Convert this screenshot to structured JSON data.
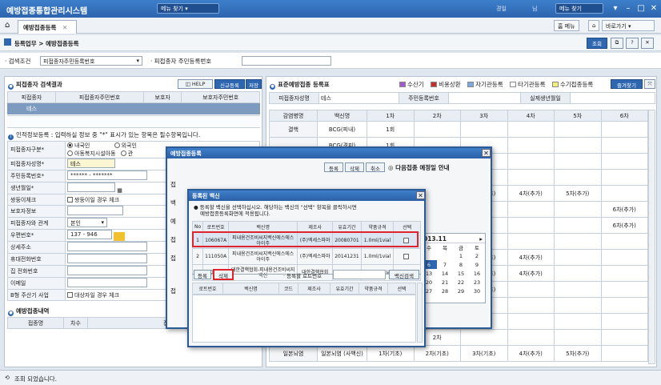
{
  "app": {
    "title": "예방접종통합관리시스템",
    "menu_pill": "메뉴 찾기",
    "menu_pill2": "메뉴 찾기",
    "top_user_a": "경일",
    "top_user_b": "님"
  },
  "tabs": [
    {
      "label": "예방접종등록"
    }
  ],
  "top_right": {
    "home": "홈 메뉴",
    "home_icon_label": "⌂",
    "logout": "바로가기 ▾"
  },
  "breadcrumb": {
    "root": "등록업무",
    "sep": ">",
    "page": "예방접종등록"
  },
  "crumb_buttons": {
    "search": "조회"
  },
  "search": {
    "cond_label": "· 검색조건",
    "cond_value": "피접종자주민등록번호",
    "rrn_label": "· 피접종자 주민등록번호"
  },
  "left": {
    "list_title": "피접종자 검색결과",
    "help": "HELP",
    "new": "신규등록",
    "save": "저장",
    "list_headers": [
      "피접종자",
      "피접종자주민번호",
      "보호자",
      "보호자주민번호"
    ],
    "list_rows": [
      [
        "테스",
        "",
        "",
        ""
      ]
    ],
    "notice": "인적정보등록 : 입력하실 정보 중 \"*\" 표시가 있는 항목은 필수항목입니다.",
    "form": [
      {
        "label": "피접종자구분*",
        "value": "내국인 / 외국인 / 아동복지시설아동 / 관"
      },
      {
        "label": "피접종자성명*",
        "value": "테스"
      },
      {
        "label": "주민등록번호*",
        "value": "****** - *******"
      },
      {
        "label": "생년월일*",
        "value": ""
      },
      {
        "label": "쌍둥이체크",
        "value": "쌍둥이일 경우 체크"
      },
      {
        "label": "보호자정보",
        "value": ""
      },
      {
        "label": "피접종자와 관계",
        "value": "본인"
      },
      {
        "label": "우편번호*",
        "value": "137 - 946"
      },
      {
        "label": "상세주소",
        "value": ""
      },
      {
        "label": "휴대전화번호",
        "value": ""
      },
      {
        "label": "집 전화번호",
        "value": ""
      },
      {
        "label": "이메일",
        "value": ""
      },
      {
        "label": "B형 주산기 사업",
        "value": "대상자일 경우 체크"
      }
    ],
    "radio": {
      "domestic": "내국인",
      "foreign": "외국인",
      "child": "아동복지시설아동",
      "etc": "관"
    },
    "hist_title": "예방접종내역",
    "hist_headers": [
      "접종명",
      "차수",
      "접종기관"
    ]
  },
  "right": {
    "title": "표준예방접종 등록표",
    "legend": [
      {
        "label": "수산기",
        "color": "#a25bc8"
      },
      {
        "label": "비용상환",
        "color": "#c6302a"
      },
      {
        "label": "자기관등록",
        "color": "#7da9e0"
      },
      {
        "label": "타기관등록",
        "color": "#ffffff"
      },
      {
        "label": "수기접종등록",
        "color": "#f2ee7a"
      }
    ],
    "fav_btn": "즐겨찾기",
    "info_labels": [
      "피접종자성명",
      "주민등록번호",
      "실제생년월일"
    ],
    "info_name": "테스",
    "headers": [
      "감염병명",
      "백신명",
      "1차",
      "2차",
      "3차",
      "4차",
      "5차",
      "6차"
    ],
    "rows": [
      [
        "결핵",
        "BCG(피내)",
        "1회",
        "",
        "",
        "",
        "",
        ""
      ],
      [
        "",
        "BCG(경피)",
        "1회",
        "",
        "",
        "",
        "",
        ""
      ],
      [
        "",
        "",
        "",
        "",
        "3차",
        "",
        "",
        ""
      ],
      [
        "",
        "",
        "",
        "",
        "3차",
        "",
        "",
        ""
      ],
      [
        "",
        "",
        "",
        "",
        "1차(기초)",
        "4차(추가)",
        "5차(추가)",
        ""
      ],
      [
        "",
        "",
        "",
        "",
        "",
        "",
        "",
        "6차(추가)"
      ],
      [
        "",
        "",
        "",
        "",
        "",
        "",
        "",
        "6차(추가)"
      ],
      [
        "",
        "",
        "",
        "",
        "3차",
        "",
        "",
        ""
      ],
      [
        "",
        "",
        "",
        "",
        "1차(기초)",
        "4차(추가)",
        "",
        ""
      ],
      [
        "",
        "",
        "",
        "",
        "1차(기초)",
        "4차(추가)",
        "",
        ""
      ],
      [
        "",
        "",
        "",
        "",
        "1차(기초)",
        "",
        "",
        ""
      ],
      [
        "",
        "",
        "",
        "",
        "",
        "",
        "",
        ""
      ],
      [
        "",
        "",
        "",
        "2차",
        "",
        "",
        "",
        ""
      ],
      [
        "",
        "",
        "",
        "2차",
        "",
        "",
        "",
        ""
      ],
      [
        "일본뇌염",
        "일본뇌염 (사백신)",
        "1차(기초)",
        "2차(기초)",
        "3차(기초)",
        "4차(추가)",
        "5차(추가)",
        ""
      ]
    ]
  },
  "dialog1": {
    "title": "예방접종등록",
    "buttons": [
      "등록",
      "삭제",
      "취소"
    ],
    "next_label": "다음접종 예정일 안내",
    "cal_month": "013.11",
    "cal_days_header": [
      "수",
      "목",
      "금",
      "토"
    ],
    "cal_rows": [
      [
        "",
        "",
        "1",
        "2"
      ],
      [
        "6",
        "7",
        "8",
        "9"
      ],
      [
        "13",
        "14",
        "15",
        "16"
      ],
      [
        "20",
        "21",
        "22",
        "23"
      ],
      [
        "27",
        "28",
        "29",
        "30"
      ]
    ],
    "sidebar_labels": [
      "접",
      "백",
      "예",
      "접",
      "접",
      "접"
    ]
  },
  "dialog2": {
    "title": "등록된 백신",
    "notice1": "등록할 백신을 선택하십시오. 해당하는 백신의 \"선택\" 항목을 클릭하시면",
    "notice2": "예방접종등록화면에 적용됩니다.",
    "headers": [
      "No",
      "로트번호",
      "백신명",
      "제조사",
      "유효기간",
      "약품규격",
      "선택"
    ],
    "rows": [
      [
        "1",
        "106067A",
        "피내용건조비씨지백신에스에스아이주",
        "(주)엑세스파마",
        "20080701",
        "1.0ml/1vial",
        ""
      ],
      [
        "2",
        "111050A",
        "피내용건조비씨지백신에스에스아이주",
        "(주)엑세스파마",
        "20141231",
        "1.0ml/1vial",
        ""
      ],
      [
        "3",
        "06-4",
        "대한결핵협회-피내용건조비씨지백신",
        "대한결핵협회",
        "20070901",
        "1.0mg/1vial",
        ""
      ]
    ],
    "reg_btn": "등록",
    "del_btn": "삭제",
    "lot_label": "· 등록할 로트번호",
    "lot_search": "백신검색",
    "lower_headers": [
      "로트번호",
      "백신명",
      "코드",
      "제조사",
      "유효기간",
      "약품규격",
      "선택"
    ]
  },
  "status": {
    "text": "조회 되었습니다."
  }
}
